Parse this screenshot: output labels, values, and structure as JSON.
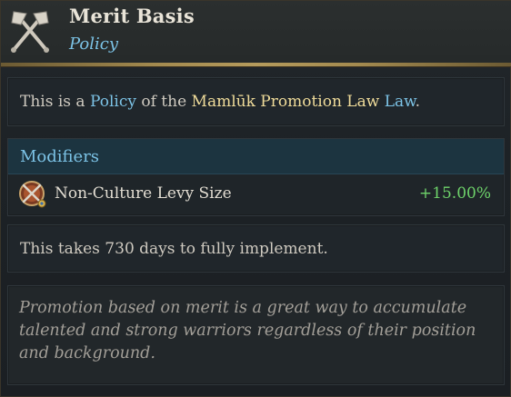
{
  "header": {
    "icon": "crossed-axes-icon",
    "title": "Merit Basis",
    "subtitle": "Policy"
  },
  "intro": {
    "prefix": "This is a ",
    "policy_word": "Policy",
    "middle": " of the ",
    "law_name": "Mamlūk Promotion Law",
    "space": " ",
    "law_word": "Law",
    "suffix": "."
  },
  "modifiers": {
    "title": "Modifiers",
    "items": [
      {
        "icon": "levy-shield-swords-icon",
        "label": "Non-Culture Levy Size",
        "value": "+15.00%"
      }
    ]
  },
  "implementation": {
    "text": "This takes 730 days to fully implement."
  },
  "flavor": {
    "text": "Promotion based on merit is a great way to accumulate talented and strong warriors regardless of their position and background."
  },
  "colors": {
    "title": "#e9e4d8",
    "accent_blue": "#7cc3e6",
    "accent_gold": "#f0dc9a",
    "positive": "#6ed36a",
    "gold_rule": "#b59b5c"
  }
}
